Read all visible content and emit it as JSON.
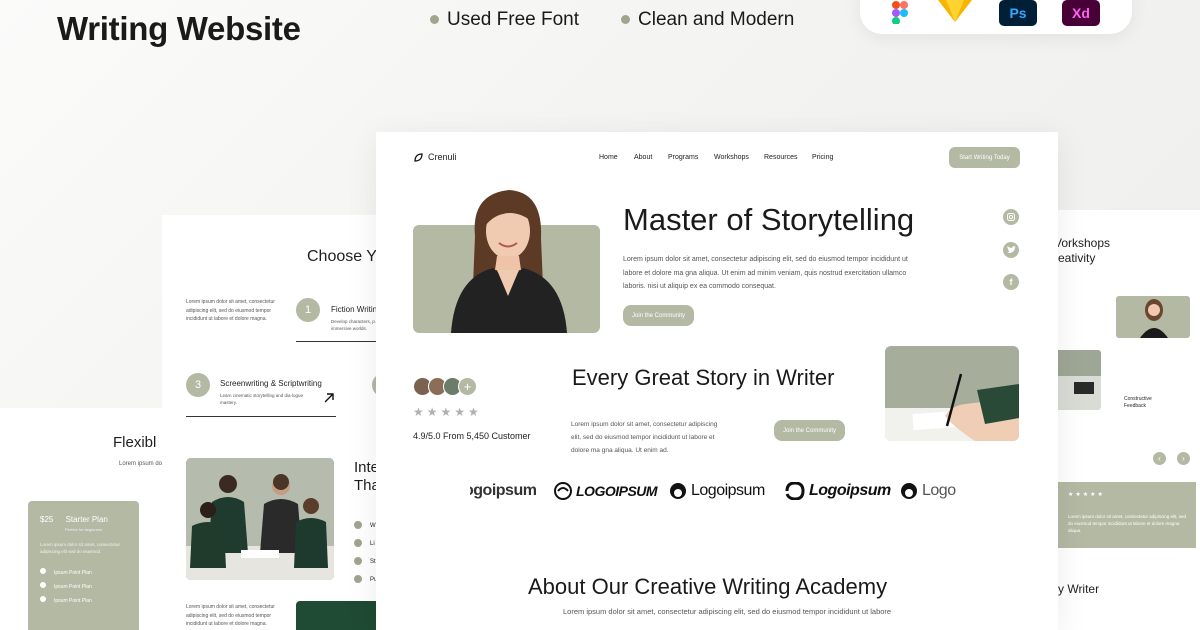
{
  "banner": {
    "title": "Writing Website",
    "features": [
      "Used Free Font",
      "Clean and Modern"
    ],
    "tools": [
      {
        "name": "figma-icon",
        "color": "#a259ff"
      },
      {
        "name": "sketch-icon",
        "color": "#f7b500"
      },
      {
        "name": "photoshop-icon",
        "label": "Ps",
        "color": "#001e36"
      },
      {
        "name": "xd-icon",
        "label": "Xd",
        "color": "#470137"
      }
    ]
  },
  "main": {
    "brand": "Crenuli",
    "nav": [
      "Home",
      "About",
      "Programs",
      "Workshops",
      "Resources",
      "Pricing"
    ],
    "cta": "Start Writing Today",
    "hero": {
      "title": "Master of Storytelling",
      "body": "Lorem ipsum dolor sit amet, consectetur adipiscing elit, sed do eiusmod tempor incididunt ut labore et dolore ma gna aliqua. Ut enim ad minim veniam, quis nostrud exercitation ullamco laboris. nisi ut aliquip ex ea commodo consequat.",
      "button": "Join the Community"
    },
    "social": [
      "instagram-icon",
      "twitter-icon",
      "facebook-icon"
    ],
    "story": {
      "title": "Every Great Story in Writer",
      "rating_text": "4.9/5.0 From 5,450 Customer",
      "stars": 5,
      "body": "Lorem ipsum dolor sit amet, consectetur adipiscing elit, sed do eiusmod tempor incididunt ut labore et dolore ma gna aliqua. Ut enim ad.",
      "button": "Join the Community"
    },
    "logos": [
      "ogoipsum",
      "LOGOIPSUM",
      "Logoipsum",
      "Logoipsum",
      "Logo"
    ],
    "about": {
      "title": "About Our Creative Writing Academy",
      "body": "Lorem ipsum dolor sit amet, consectetur adipiscing elit, sed do eiusmod tempor incididunt ut labore"
    }
  },
  "left_page": {
    "title": "Choose Y",
    "intro": "Lorem ipsum dolor sit amet, consectetur adipiscing elit, sed do eiusmod tempor incididunt ut labore et dolore magna.",
    "items": [
      {
        "num": "1",
        "title": "Fiction Writin",
        "desc": "Develop characters, p... immersive worlds."
      },
      {
        "num": "3",
        "title": "Screenwriting & Scriptwriting",
        "desc": "Learn cinematic storytelling and dia-logue mastery."
      }
    ],
    "heading2": [
      "Inte",
      "Tha"
    ],
    "list": [
      "W",
      "Li",
      "St",
      "Pu"
    ],
    "body2": "Lorem ipsum dolor sit amet, consectetur adipiscing elit, sed do eiusmod tempor incididunt ut labore et dolore magna."
  },
  "far_left": {
    "title": "Flexibl",
    "intro": "Lorem ipsum do",
    "plan": {
      "price": "$25",
      "name": "Starter Plan",
      "subtitle": "Perfect for beginners",
      "desc": "Lorem ipsum dolor sit amet, consectetur adipiscing elit sed do eiusmod.",
      "features": [
        "Ipsum Point Plan",
        "Ipsum Point Plan",
        "Ipsum Point Plan"
      ]
    }
  },
  "right_page": {
    "heading": [
      "Vorkshops",
      "reativity"
    ],
    "caption": "Constructive Feedback",
    "testimonial": "Lorem ipsum dolor sit amet, consectetur adipiscing elit, sed do eiusmod tempor incididunt ut labore et dolore magna aliqua.",
    "bottom": "ry Writer"
  }
}
